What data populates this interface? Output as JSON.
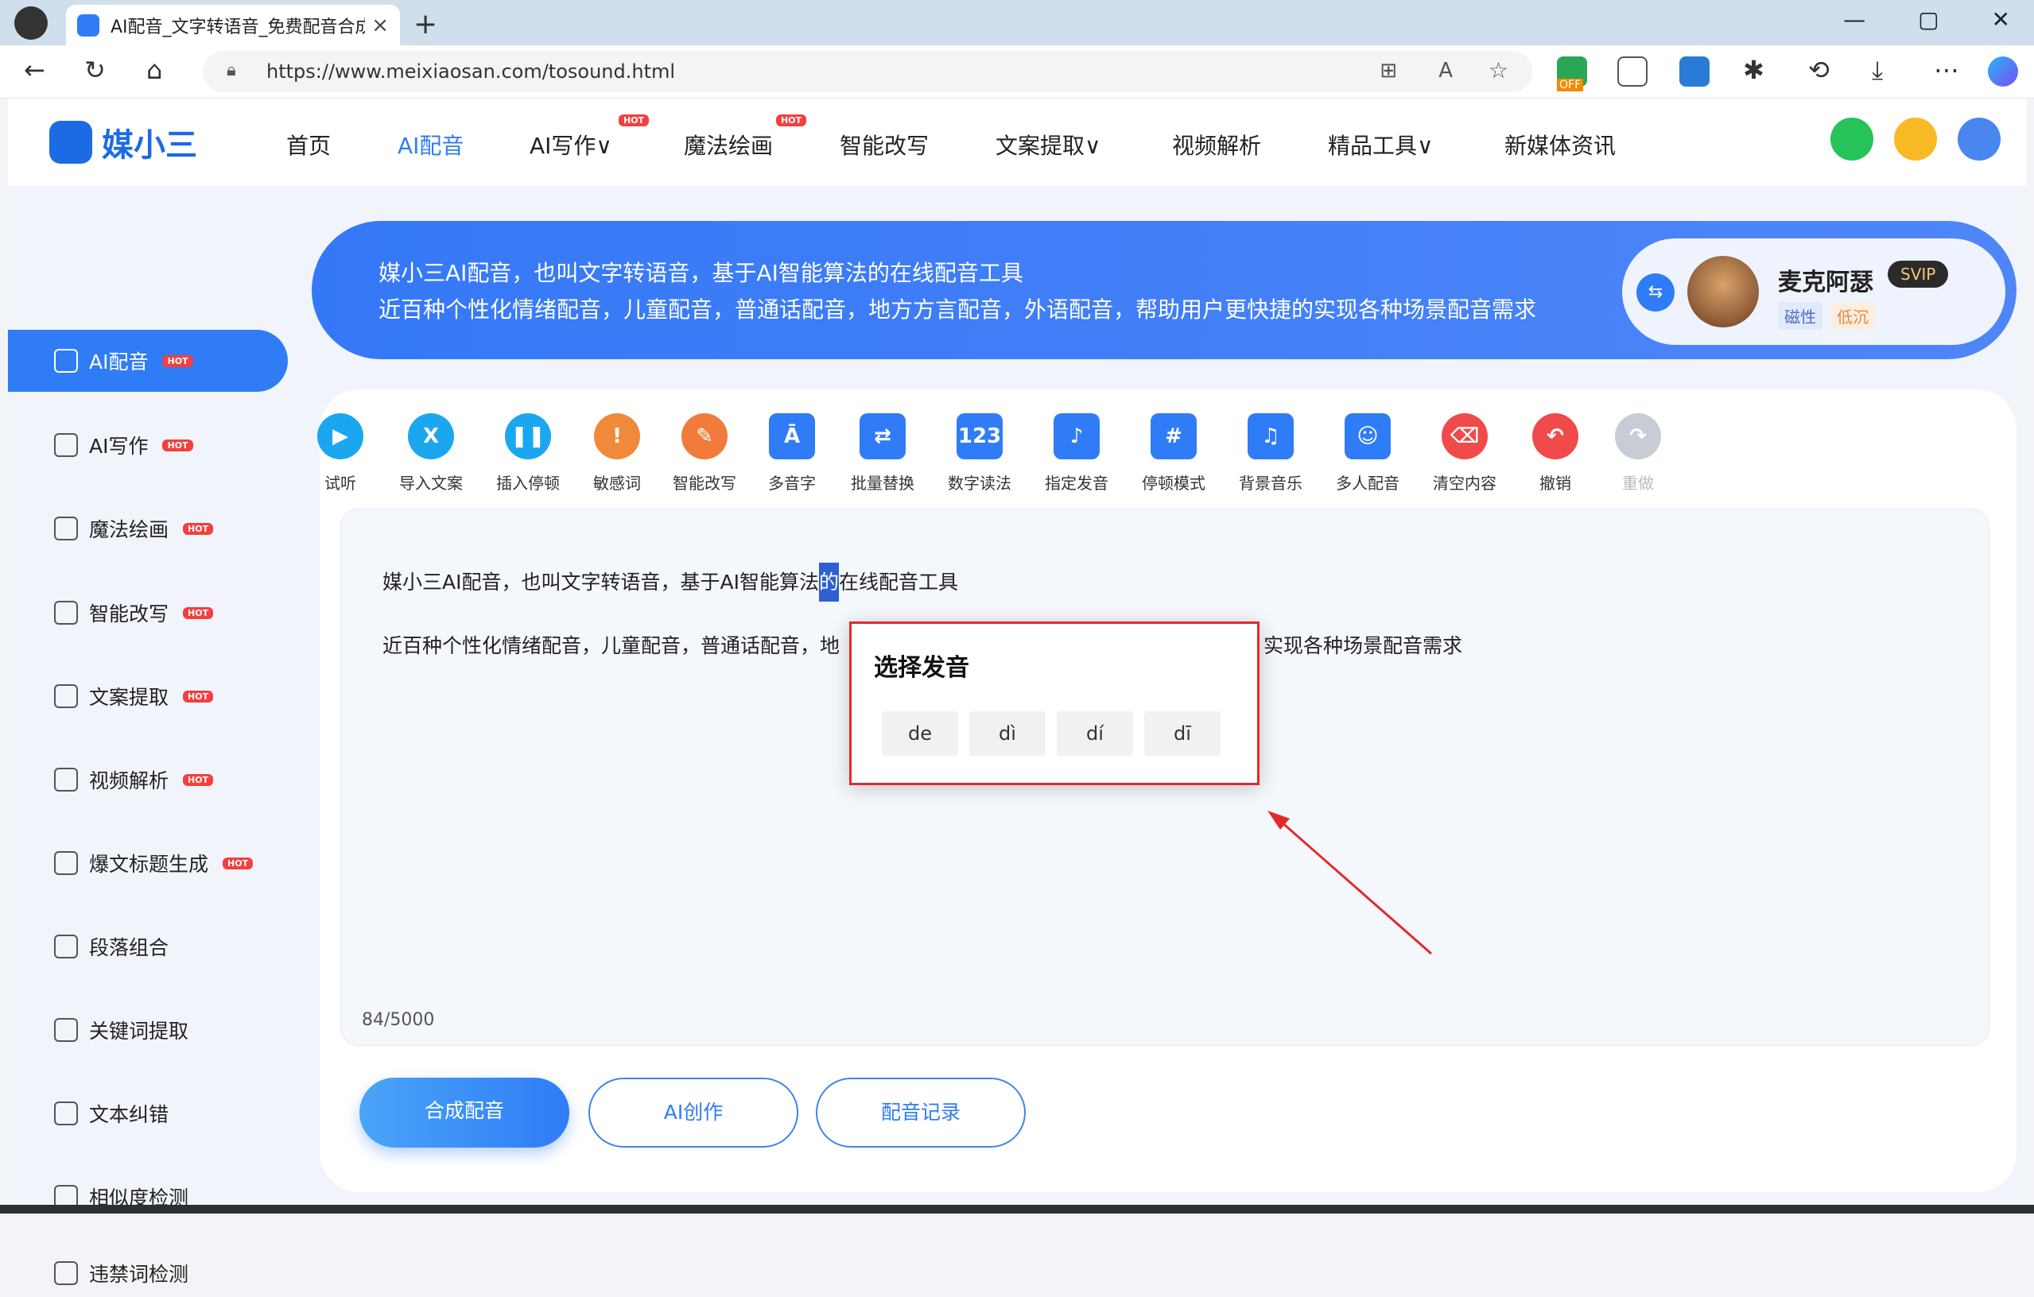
{
  "browser": {
    "tab_title": "AI配音_文字转语音_免费配音合成",
    "tab_close": "×",
    "new_tab": "+",
    "url": "https://www.meixiaosan.com/tosound.html",
    "window_buttons": [
      "—",
      "▢",
      "✕"
    ],
    "ext_badge": "OFF"
  },
  "site": {
    "logo_text": "媒小三",
    "nav": [
      {
        "label": "首页"
      },
      {
        "label": "AI配音",
        "active": true
      },
      {
        "label": "AI写作∨",
        "hot": true
      },
      {
        "label": "魔法绘画",
        "hot": true
      },
      {
        "label": "智能改写"
      },
      {
        "label": "文案提取∨"
      },
      {
        "label": "视频解析"
      },
      {
        "label": "精品工具∨"
      },
      {
        "label": "新媒体资讯"
      }
    ],
    "hot_label": "HOT"
  },
  "sidebar": {
    "items": [
      {
        "label": "AI配音",
        "hot": true,
        "active": true
      },
      {
        "label": "AI写作",
        "hot": true
      },
      {
        "label": "魔法绘画",
        "hot": true
      },
      {
        "label": "智能改写",
        "hot": true
      },
      {
        "label": "文案提取",
        "hot": true
      },
      {
        "label": "视频解析",
        "hot": true
      },
      {
        "label": "爆文标题生成",
        "hot": true
      },
      {
        "label": "段落组合"
      },
      {
        "label": "关键词提取"
      },
      {
        "label": "文本纠错"
      },
      {
        "label": "相似度检测"
      },
      {
        "label": "违禁词检测"
      }
    ]
  },
  "banner": {
    "line1": "媒小三AI配音，也叫文字转语音，基于AI智能算法的在线配音工具",
    "line2": "近百种个性化情绪配音，儿童配音，普通话配音，地方方言配音，外语配音，帮助用户更快捷的实现各种场景配音需求",
    "voice_name": "麦克阿瑟",
    "voice_badge": "SVIP",
    "tags": [
      "磁性",
      "低沉"
    ]
  },
  "toolbar": {
    "tools": [
      {
        "label": "试听",
        "glyph": "▶",
        "color": "#1aa7f0"
      },
      {
        "label": "导入文案",
        "glyph": "X",
        "color": "#1aa7f0"
      },
      {
        "label": "插入停顿",
        "glyph": "❚❚",
        "color": "#1aa7f0"
      },
      {
        "label": "敏感词",
        "glyph": "!",
        "color": "#f08a3a"
      },
      {
        "label": "智能改写",
        "glyph": "✎",
        "color": "#f07b3a"
      },
      {
        "label": "多音字",
        "glyph": "Ā",
        "color": "#2f7cf6"
      },
      {
        "label": "批量替换",
        "glyph": "⇄",
        "color": "#2f7cf6"
      },
      {
        "label": "数字读法",
        "glyph": "123",
        "color": "#2f7cf6"
      },
      {
        "label": "指定发音",
        "glyph": "♪",
        "color": "#2f7cf6"
      },
      {
        "label": "停顿模式",
        "glyph": "#",
        "color": "#2f7cf6"
      },
      {
        "label": "背景音乐",
        "glyph": "♫",
        "color": "#2f7cf6"
      },
      {
        "label": "多人配音",
        "glyph": "☺",
        "color": "#2f7cf6"
      },
      {
        "label": "清空内容",
        "glyph": "⌫",
        "color": "#f04a4a"
      },
      {
        "label": "撤销",
        "glyph": "↶",
        "color": "#f04a4a"
      },
      {
        "label": "重做",
        "glyph": "↷",
        "color": "#c8ccd4"
      }
    ]
  },
  "editor": {
    "line1_before": "媒小三AI配音，也叫文字转语音，基于AI智能算法",
    "line1_sel": "的",
    "line1_after": "在线配音工具",
    "line2_left": "近百种个性化情绪配音，儿童配音，普通话配音，地",
    "line2_right": "实现各种场景配音需求",
    "counter": "84/5000"
  },
  "popup": {
    "title": "选择发音",
    "options": [
      "de",
      "dì",
      "dí",
      "dī"
    ]
  },
  "actions": {
    "synth": "合成配音",
    "ai_create": "AI创作",
    "history": "配音记录"
  },
  "colors": {
    "accent": "#2f7cf6",
    "annotation": "#e32a2a"
  }
}
